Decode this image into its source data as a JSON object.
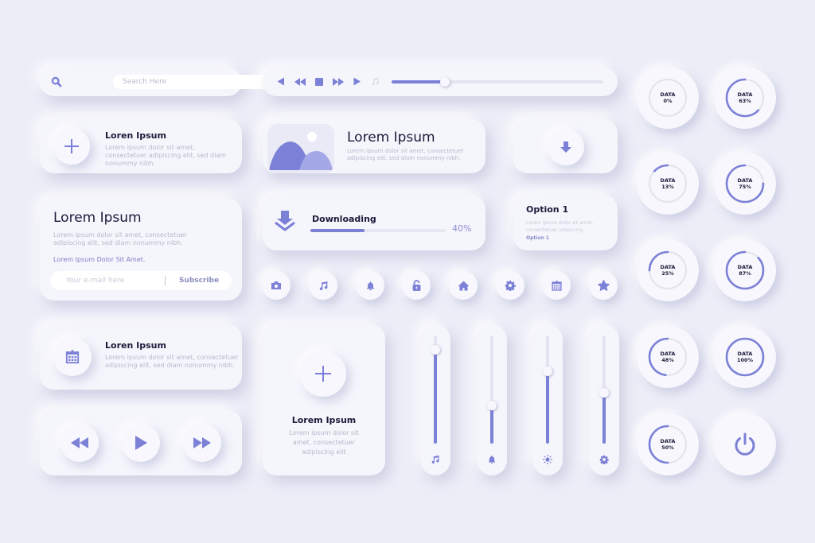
{
  "theme": {
    "accent": "#7c80d6",
    "accent_light": "#a5a8e6",
    "background": "#ecedf7",
    "card": "#f5f5fc",
    "text_dark": "#1c1b3a",
    "text_muted": "#b9b9cb"
  },
  "search": {
    "placeholder": "Search Here",
    "icon": "search-icon"
  },
  "media_bar": {
    "controls": [
      "previous-icon",
      "rewind-icon",
      "stop-icon",
      "fast-forward-icon",
      "play-icon",
      "music-note-icon"
    ],
    "progress": 0.25
  },
  "add_card": {
    "title": "Loren Ipsum",
    "body": "Lorem ipsum dolor sit amet, consectetuer adipiscing elit, sed diam nonummy nibh.",
    "icon": "plus-icon"
  },
  "image_card": {
    "title": "Lorem Ipsum",
    "body": "Lorem ipsum dolor sit amet, consectetuer adipiscing elit, sed diam nonummy nibh.",
    "icon": "image-icon"
  },
  "download_button": {
    "icon": "download-arrow-icon"
  },
  "subscribe_card": {
    "title": "Lorem Ipsum",
    "body": "Lorem ipsum dolor sit amet, consectetuer adipiscing elit, sed diam nonummy nibh.",
    "link": "Lorem Ipsum Dolor Sit Amet.",
    "email_placeholder": "Your e-mail here",
    "subscribe_label": "Subscribe"
  },
  "download_card": {
    "title": "Downloading",
    "percent_label": "40%",
    "progress": 0.4,
    "icon": "download-tray-icon"
  },
  "option_card": {
    "title": "Option 1",
    "body": "Lorem ipsum dolor sit amet, consectetuer adipiscing",
    "link": "Option 1"
  },
  "icon_row": [
    "camera-icon",
    "music-note-icon",
    "bell-icon",
    "unlock-icon",
    "home-icon",
    "gear-icon",
    "calendar-icon",
    "star-icon"
  ],
  "calendar_card": {
    "title": "Loren Ipsum",
    "body": "Lorem ipsum dolor sit amet, consectetuer adipiscing elit, sed diam nonummy nibh.",
    "icon": "calendar-icon"
  },
  "player_card": {
    "buttons": [
      "rewind-icon",
      "play-icon",
      "fast-forward-icon"
    ]
  },
  "big_add_card": {
    "title": "Lorem Ipsum",
    "body": "Lorem ipsum dolor sit amet, consectetuer adipiscing elit",
    "icon": "plus-icon"
  },
  "vertical_sliders": [
    {
      "name": "music",
      "icon": "music-note-icon",
      "value": 0.87
    },
    {
      "name": "notifications",
      "icon": "bell-icon",
      "value": 0.35
    },
    {
      "name": "brightness",
      "icon": "sun-icon",
      "value": 0.67
    },
    {
      "name": "settings",
      "icon": "gear-icon",
      "value": 0.47
    }
  ],
  "gauges": [
    {
      "label": "DATA",
      "value_label": "0%",
      "value": 0
    },
    {
      "label": "DATA",
      "value_label": "63%",
      "value": 0.63
    },
    {
      "label": "DATA",
      "value_label": "13%",
      "value": 0.13
    },
    {
      "label": "DATA",
      "value_label": "75%",
      "value": 0.75
    },
    {
      "label": "DATA",
      "value_label": "25%",
      "value": 0.25
    },
    {
      "label": "DATA",
      "value_label": "87%",
      "value": 0.87
    },
    {
      "label": "DATA",
      "value_label": "48%",
      "value": 0.48
    },
    {
      "label": "DATA",
      "value_label": "100%",
      "value": 1.0
    },
    {
      "label": "DATA",
      "value_label": "50%",
      "value": 0.5
    }
  ],
  "power_button": {
    "icon": "power-icon"
  }
}
